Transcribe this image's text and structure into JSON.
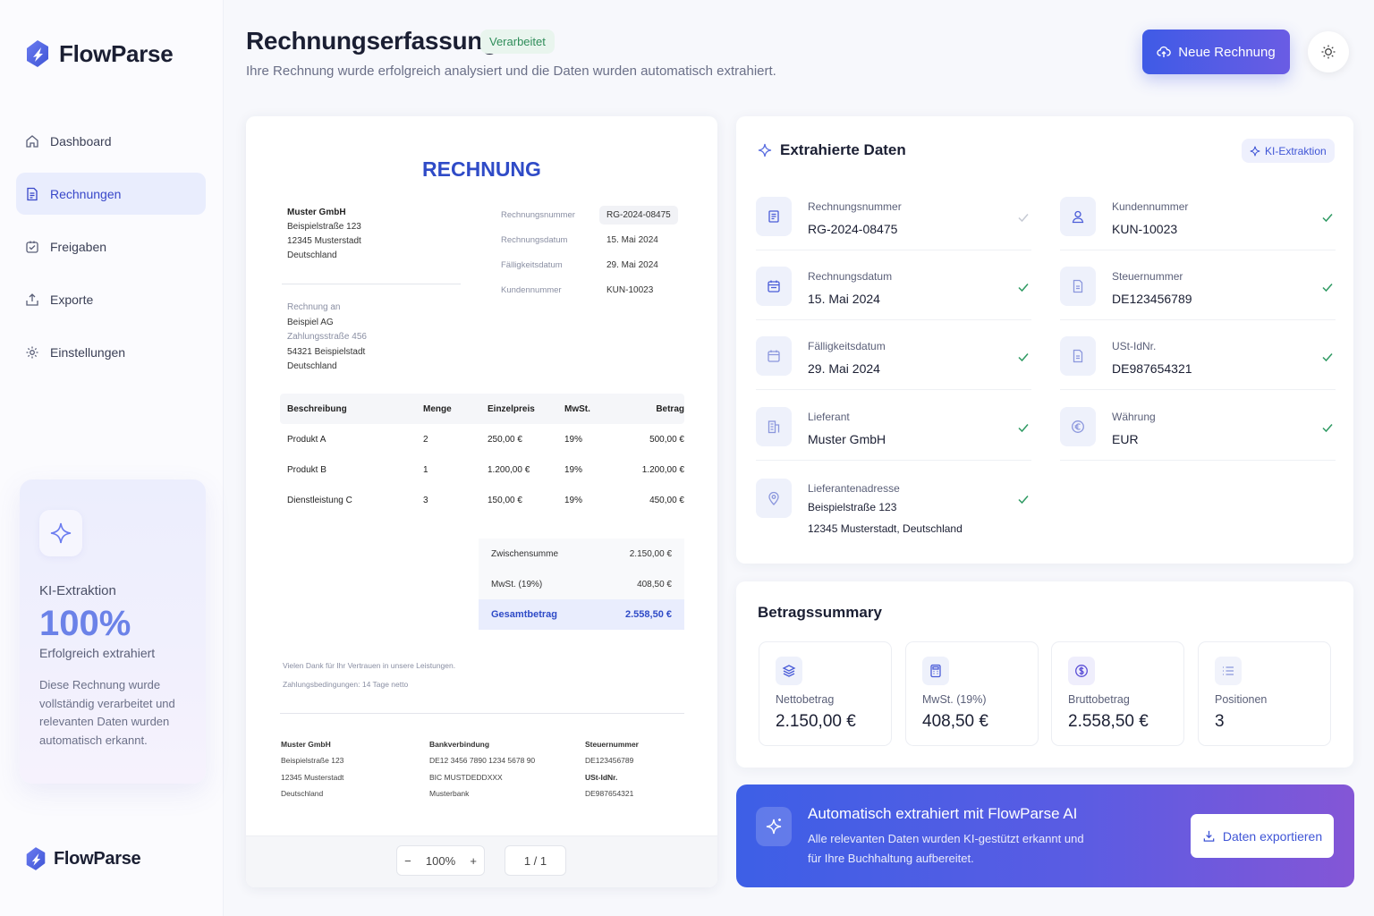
{
  "app": {
    "name": "FlowParse"
  },
  "sidebar": {
    "items": [
      {
        "label": "Dashboard",
        "icon": "home-icon"
      },
      {
        "label": "Rechnungen",
        "icon": "file-text-icon",
        "active": true
      },
      {
        "label": "Freigaben",
        "icon": "approval-icon"
      },
      {
        "label": "Exporte",
        "icon": "upload-icon"
      },
      {
        "label": "Einstellungen",
        "icon": "gear-icon"
      }
    ],
    "ki_card": {
      "title": "KI-Extraktion",
      "percent": "100%",
      "subtitle": "Erfolgreich extrahiert",
      "description": "Diese Rechnung wurde vollständig verarbeitet und relevanten Daten wurden automatisch erkannt."
    }
  },
  "header": {
    "title": "Rechnungserfassung",
    "status": "Verarbeitet",
    "subtitle": "Ihre Rechnung wurde erfolgreich analysiert und die Daten wurden automatisch extrahiert.",
    "new_button": "Neue Rechnung"
  },
  "invoice": {
    "title": "RECHNUNG",
    "seller": {
      "name": "Muster GmbH",
      "street": "Beispielstraße 123",
      "city": "12345 Musterstadt",
      "country": "Deutschland"
    },
    "meta": [
      {
        "key": "Rechnungsnummer",
        "value": "RG-2024-08475"
      },
      {
        "key": "Rechnungsdatum",
        "value": "15. Mai 2024"
      },
      {
        "key": "Fälligkeitsdatum",
        "value": "29. Mai 2024"
      },
      {
        "key": "Kundennummer",
        "value": "KUN-10023"
      }
    ],
    "recipient": {
      "label": "Rechnung an",
      "name": "Beispiel AG",
      "street": "Zahlungsstraße 456",
      "city": "54321 Beispielstadt",
      "country": "Deutschland"
    },
    "table": {
      "headers": [
        "Beschreibung",
        "Menge",
        "Einzelpreis",
        "MwSt.",
        "Betrag"
      ],
      "rows": [
        [
          "Produkt A",
          "2",
          "250,00 €",
          "19%",
          "500,00 €"
        ],
        [
          "Produkt B",
          "1",
          "1.200,00 €",
          "19%",
          "1.200,00 €"
        ],
        [
          "Dienstleistung C",
          "3",
          "150,00 €",
          "19%",
          "450,00 €"
        ]
      ]
    },
    "totals": {
      "subtotal_label": "Zwischensumme",
      "subtotal": "2.150,00 €",
      "tax_label": "MwSt. (19%)",
      "tax": "408,50 €",
      "total_label": "Gesamtbetrag",
      "total": "2.558,50 €"
    },
    "thanks": "Vielen Dank für Ihr Vertrauen in unsere Leistungen.",
    "terms": "Zahlungsbedingungen: 14 Tage netto",
    "footer": {
      "col1": {
        "title": "Muster GmbH",
        "l1": "Beispielstraße 123",
        "l2": "12345 Musterstadt",
        "l3": "Deutschland"
      },
      "col2": {
        "title": "Bankverbindung",
        "l1": "DE12 3456 7890 1234 5678 90",
        "l2": "BIC MUSTDEDDXXX",
        "l3": "Musterbank"
      },
      "col3": {
        "title": "Steuernummer",
        "l1": "DE123456789",
        "l2": "USt-IdNr.",
        "l3": "DE987654321"
      }
    }
  },
  "viewer": {
    "zoom": "100%",
    "page": "1 / 1",
    "zoom_out": "−",
    "zoom_in": "+"
  },
  "extracted": {
    "title": "Extrahierte Daten",
    "badge": "KI-Extraktion",
    "fields": {
      "invoice_number": {
        "label": "Rechnungsnummer",
        "value": "RG-2024-08475"
      },
      "customer_number": {
        "label": "Kundennummer",
        "value": "KUN-10023"
      },
      "invoice_date": {
        "label": "Rechnungsdatum",
        "value": "15. Mai 2024"
      },
      "tax_number": {
        "label": "Steuernummer",
        "value": "DE123456789"
      },
      "due_date": {
        "label": "Fälligkeitsdatum",
        "value": "29. Mai 2024"
      },
      "vat_id": {
        "label": "USt-IdNr.",
        "value": "DE987654321"
      },
      "supplier": {
        "label": "Lieferant",
        "value": "Muster GmbH"
      },
      "currency": {
        "label": "Währung",
        "value": "EUR"
      },
      "supplier_address": {
        "label": "Lieferantenadresse",
        "line1": "Beispielstraße 123",
        "line2": "12345 Musterstadt, Deutschland"
      }
    }
  },
  "summary": {
    "title": "Betragssummary",
    "cards": [
      {
        "label": "Nettobetrag",
        "value": "2.150,00 €",
        "icon": "layers-icon"
      },
      {
        "label": "MwSt. (19%)",
        "value": "408,50 €",
        "icon": "calculator-icon"
      },
      {
        "label": "Bruttobetrag",
        "value": "2.558,50 €",
        "icon": "dollar-circle-icon"
      },
      {
        "label": "Positionen",
        "value": "3",
        "icon": "list-icon"
      }
    ]
  },
  "banner": {
    "title": "Automatisch extrahiert mit FlowParse AI",
    "description": "Alle relevanten Daten wurden KI-gestützt erkannt und für Ihre Buchhaltung aufbereitet.",
    "export_button": "Daten exportieren"
  },
  "colors": {
    "accent": "#3f55d6",
    "success": "#2f8d5a",
    "brand_gradient_start": "#3d5fe6",
    "brand_gradient_end": "#8456d6"
  }
}
